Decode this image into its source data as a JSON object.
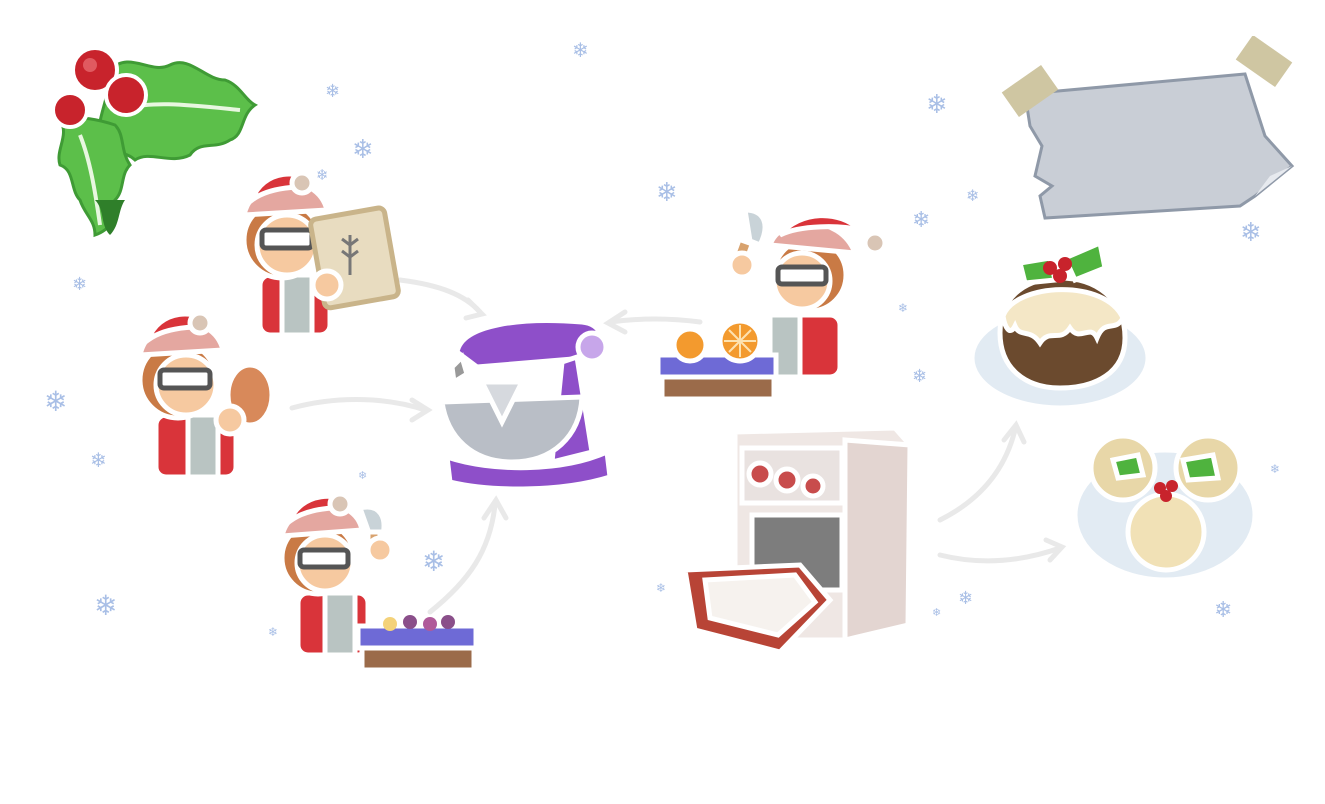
{
  "scene": {
    "background": "#ffffff",
    "colors": {
      "holly_leaf": "#5cbf4a",
      "berry": "#c8232c",
      "mixer": "#8e4fc9",
      "santa_red": "#d9343a",
      "snowflake": "#a9bfe6",
      "note_paper": "#c9ced6",
      "tape": "#cfc6a2"
    },
    "note": {
      "text": ""
    },
    "icons": [
      "holly-decoration-icon",
      "baker-flour-icon",
      "baker-egg-icon",
      "baker-knife-fruit-icon",
      "baker-knife-orange-icon",
      "stand-mixer-icon",
      "oven-icon",
      "christmas-pudding-icon",
      "mince-pies-icon",
      "flow-arrow-icon",
      "snowflake-icon"
    ],
    "snowflake_glyph": "❄"
  }
}
